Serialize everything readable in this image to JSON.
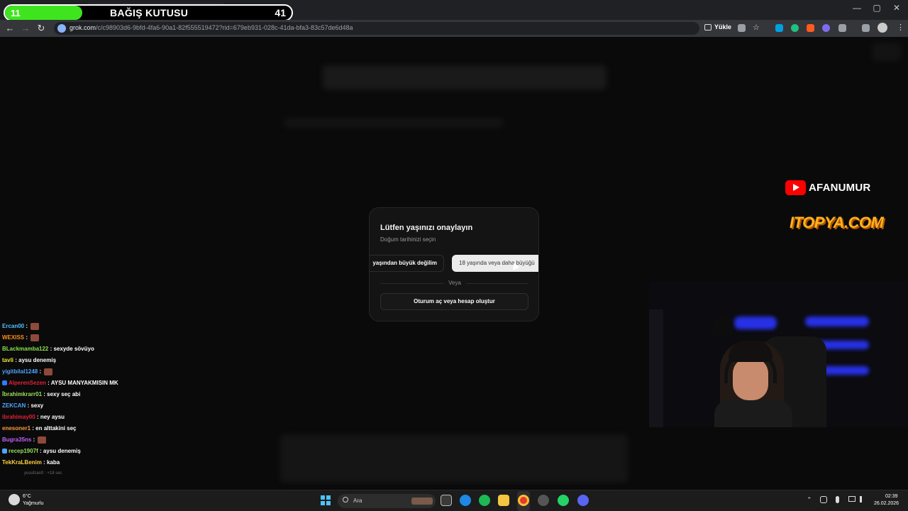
{
  "donation": {
    "left_value": "11",
    "title": "BAĞIŞ KUTUSU",
    "right_value": "41",
    "progress_fraction": 0.27
  },
  "browser": {
    "url_host": "grok.com",
    "url_path": "/c/c98903d6-9bfd-4fa6-90a1-82f555519472?rid=679eb931-028c-41da-bfa3-83c57de6d48a",
    "install_label": "Yükle",
    "tab_close": "×",
    "tab_new": "+",
    "win_min": "—",
    "win_max": "▢",
    "win_close": "✕",
    "back": "←",
    "forward": "→",
    "reload": "↻",
    "star": "☆",
    "menu": "⋮"
  },
  "modal": {
    "title": "Lütfen yaşınızı onaylayın",
    "subtitle": "Doğum tarihinizi seçin",
    "under_button": "yaşından büyük değilim",
    "over_button": "18 yaşında veya daha büyüğü",
    "or_text": "Veya",
    "login_button": "Oturum aç veya hesap oluştur"
  },
  "overlays": {
    "youtube_name": "AFANUMUR",
    "sponsor": "ITOPYA.COM"
  },
  "chat": [
    {
      "user": "Ercan00",
      "msg": "",
      "color": "#4fc3ff",
      "emote": true,
      "badge": ""
    },
    {
      "user": "WEXISS",
      "msg": "",
      "color": "#ff8c1a",
      "emote": true,
      "badge": ""
    },
    {
      "user": "BLackmamba122",
      "msg": "sexyde sövüyo",
      "color": "#8be04e",
      "emote": false,
      "badge": ""
    },
    {
      "user": "tavli",
      "msg": "aysu denemiş",
      "color": "#e8e83a",
      "emote": false,
      "badge": ""
    },
    {
      "user": "yigitbilal1248",
      "msg": "",
      "color": "#4fa3ff",
      "emote": true,
      "badge": ""
    },
    {
      "user": "AlperenSezen",
      "msg": "AYSU MANYAKMISIN MK",
      "color": "#e0203a",
      "emote": false,
      "badge": "#2a7fff"
    },
    {
      "user": "İbrahimkrarr01",
      "msg": "sexy seç abi",
      "color": "#9be05a",
      "emote": false,
      "badge": ""
    },
    {
      "user": "ZEKCAN",
      "msg": "sexy",
      "color": "#4fa3ff",
      "emote": false,
      "badge": ""
    },
    {
      "user": "ibrahimay00",
      "msg": "ney aysu",
      "color": "#e0203a",
      "emote": false,
      "badge": ""
    },
    {
      "user": "enesoner1",
      "msg": "en alttakini seç",
      "color": "#ff9a3a",
      "emote": false,
      "badge": ""
    },
    {
      "user": "Bugra35ns",
      "msg": "",
      "color": "#c060ff",
      "emote": true,
      "badge": ""
    },
    {
      "user": "recep1907f",
      "msg": "aysu denemiş",
      "color": "#9be05a",
      "emote": false,
      "badge": "#4fa3ff"
    },
    {
      "user": "TekKraLBenim",
      "msg": "kaba",
      "color": "#ffd23a",
      "emote": false,
      "badge": ""
    }
  ],
  "chat_footer": "yusufcan0 : +18 sec",
  "taskbar": {
    "temperature": "6°C",
    "weather": "Yağmurlu",
    "search_placeholder": "Ara",
    "time": "02:39",
    "date": "26.02.2026"
  }
}
